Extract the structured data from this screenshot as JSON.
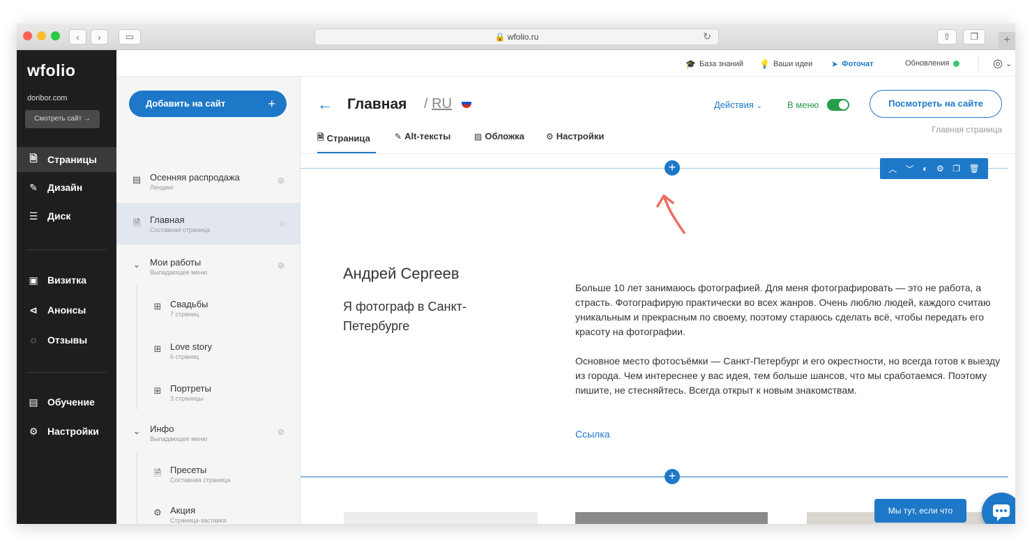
{
  "browser": {
    "url": "wfolio.ru",
    "traffic": {
      "close": "#fe5f57",
      "min": "#febc2e",
      "max": "#28c840"
    }
  },
  "brand": {
    "logo": "wfolio",
    "domain": "doribor.com",
    "view_site": "Смотреть сайт →"
  },
  "nav": {
    "top": [
      {
        "label": "Страницы",
        "icon": "page-icon",
        "glyph": "🗎",
        "active": true
      },
      {
        "label": "Дизайн",
        "icon": "brush-icon",
        "glyph": "✎",
        "active": false
      },
      {
        "label": "Диск",
        "icon": "database-icon",
        "glyph": "☰",
        "active": false
      }
    ],
    "middle": [
      {
        "label": "Визитка",
        "icon": "id-card-icon",
        "glyph": "▣"
      },
      {
        "label": "Анонсы",
        "icon": "megaphone-icon",
        "glyph": "⊲"
      },
      {
        "label": "Отзывы",
        "icon": "chat-bubbles-icon",
        "glyph": "◌"
      }
    ],
    "bottom": [
      {
        "label": "Обучение",
        "icon": "book-icon",
        "glyph": "▤"
      },
      {
        "label": "Настройки",
        "icon": "gear-icon",
        "glyph": "⚙"
      }
    ]
  },
  "topbar": {
    "knowledge": "База знаний",
    "ideas": "Ваши идеи",
    "photochat": "Фоточат",
    "updates": "Обновления",
    "updates_status_color": "#3cc96a"
  },
  "pages_panel": {
    "add_label": "Добавить на сайт",
    "add_plus": "+",
    "items": [
      {
        "title": "Осенняя распродажа",
        "sub": "Лендинг",
        "icon": "landing-icon",
        "glyph": "▤",
        "right": "hidden-eye-icon",
        "right_glyph": "⊘",
        "level": 0,
        "active": false
      },
      {
        "title": "Главная",
        "sub": "Составная страница",
        "icon": "page-icon",
        "glyph": "🗎",
        "right": "home-icon",
        "right_glyph": "⌂",
        "level": 0,
        "active": true
      },
      {
        "title": "Мои работы",
        "sub": "Выпадающее меню",
        "icon": "chevron-down-icon",
        "glyph": "⌄",
        "right": "hidden-eye-icon",
        "right_glyph": "⊘",
        "level": 0,
        "active": false
      },
      {
        "title": "Свадьбы",
        "sub": "7 страниц",
        "icon": "grid-icon",
        "glyph": "⊞",
        "level": 1,
        "active": false
      },
      {
        "title": "Love story",
        "sub": "6 страниц",
        "icon": "grid-icon",
        "glyph": "⊞",
        "level": 1,
        "active": false
      },
      {
        "title": "Портреты",
        "sub": "3 страницы",
        "icon": "grid-icon",
        "glyph": "⊞",
        "level": 1,
        "active": false
      },
      {
        "title": "Инфо",
        "sub": "Выпадающее меню",
        "icon": "chevron-down-icon",
        "glyph": "⌄",
        "right": "hidden-eye-icon",
        "right_glyph": "⊘",
        "level": 0,
        "active": false
      },
      {
        "title": "Пресеты",
        "sub": "Составная страница",
        "icon": "page-icon",
        "glyph": "🗎",
        "level": 1,
        "active": false
      },
      {
        "title": "Акция",
        "sub": "Страница-заставка",
        "icon": "gear-icon",
        "glyph": "⚙",
        "level": 1,
        "active": false
      }
    ]
  },
  "main": {
    "title": "Главная",
    "lang_sep": "/",
    "lang": "RU",
    "actions": "Действия",
    "in_menu": "В меню",
    "view_on_site": "Посмотреть на сайте",
    "page_label": "Главная страница",
    "tabs": [
      {
        "label": "Страница",
        "icon": "page-icon",
        "glyph": "🗎"
      },
      {
        "label": "Alt-тексты",
        "icon": "edit-icon",
        "glyph": "✎"
      },
      {
        "label": "Обложка",
        "icon": "image-icon",
        "glyph": "▨"
      },
      {
        "label": "Настройки",
        "icon": "gear-icon",
        "glyph": "⚙"
      }
    ],
    "block_tools": [
      {
        "name": "move-up-icon",
        "glyph": "︿"
      },
      {
        "name": "move-down-icon",
        "glyph": "﹀"
      },
      {
        "name": "palette-icon",
        "glyph": "◐"
      },
      {
        "name": "gear-icon",
        "glyph": "⚙"
      },
      {
        "name": "copy-icon",
        "glyph": "❐"
      },
      {
        "name": "trash-icon",
        "glyph": "🗑"
      }
    ],
    "name": "Андрей Сергеев",
    "tagline": "Я фотограф в Санкт-Петербурге",
    "para1": "Больше 10 лет занимаюсь фотографией. Для меня фотографировать — это не работа, а страсть. Фотографирую практически во всех жанров. Очень люблю людей, каждого считаю уникальным и прекрасным по своему, поэтому стараюсь сделать всё, чтобы передать его красоту на фотографии.",
    "para2": "Основное место фотосъёмки — Санкт-Петербург и его окрестности, но всегда готов к выезду из города. Чем интереснее у вас идея, тем больше шансов, что мы сработаемся. Поэтому пишите, не стесняйтесь. Всегда открыт к новым знакомствам.",
    "link": "Ссылка",
    "chat_label": "Мы тут, если что"
  }
}
